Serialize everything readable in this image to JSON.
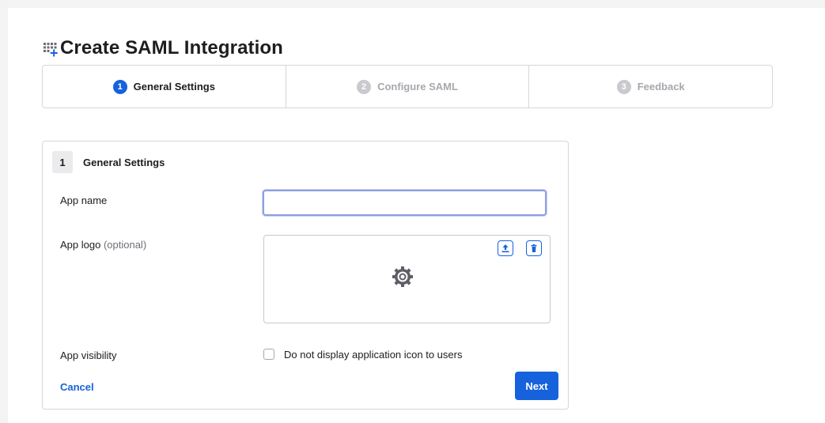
{
  "page": {
    "title": "Create SAML Integration",
    "title_icon": "apps-add-icon"
  },
  "stepper": {
    "steps": [
      {
        "number": "1",
        "label": "General Settings",
        "state": "active"
      },
      {
        "number": "2",
        "label": "Configure SAML",
        "state": "inactive"
      },
      {
        "number": "3",
        "label": "Feedback",
        "state": "inactive"
      }
    ]
  },
  "section": {
    "number": "1",
    "title": "General Settings"
  },
  "form": {
    "app_name_label": "App name",
    "app_name_value": "",
    "app_logo_label": "App logo",
    "app_logo_optional": "(optional)",
    "app_visibility_label": "App visibility",
    "visibility_checkbox_label": "Do not display application icon to users",
    "visibility_checked": false
  },
  "actions": {
    "cancel_label": "Cancel",
    "next_label": "Next"
  },
  "colors": {
    "accent": "#1662dd",
    "inactive_step": "#a7a8ad",
    "border": "#d7d7dc"
  },
  "icons": {
    "upload": "upload-icon",
    "delete": "trash-icon",
    "placeholder_logo": "gear-icon"
  }
}
